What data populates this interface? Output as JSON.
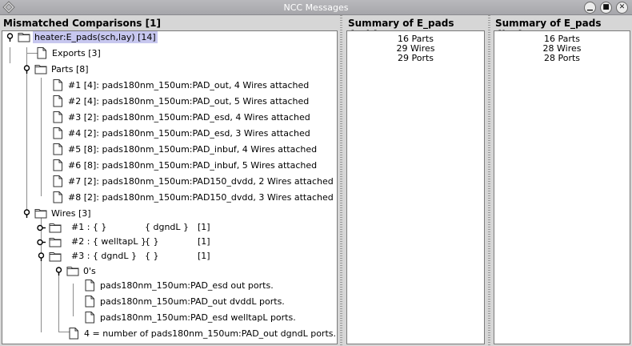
{
  "window": {
    "title": "NCC Messages"
  },
  "left_pane": {
    "header": "Mismatched Comparisons [1]",
    "tree": {
      "root": "heater:E_pads(sch,lay) [14]",
      "exports": "Exports [3]",
      "parts": "Parts [8]",
      "part_items": [
        "#1 [4]: pads180nm_150um:PAD_out, 4 Wires attached",
        "#2 [4]: pads180nm_150um:PAD_out, 5 Wires attached",
        "#3 [2]: pads180nm_150um:PAD_esd, 4 Wires attached",
        "#4 [2]: pads180nm_150um:PAD_esd, 3 Wires attached",
        "#5 [8]: pads180nm_150um:PAD_inbuf, 4 Wires attached",
        "#6 [8]: pads180nm_150um:PAD_inbuf, 5 Wires attached",
        "#7 [2]: pads180nm_150um:PAD150_dvdd, 2 Wires attached",
        "#8 [2]: pads180nm_150um:PAD150_dvdd, 3 Wires attached"
      ],
      "wires": "Wires [3]",
      "wire_items": [
        {
          "id": "#1 : { }",
          "col2": "{ dgndL }",
          "col3": "[1]"
        },
        {
          "id": "#2 : { welltapL }",
          "col2": "{ }",
          "col3": "[1]"
        },
        {
          "id": "#3 : { dgndL }",
          "col2": "{ }",
          "col3": "[1]"
        }
      ],
      "zeros": "0's",
      "zero_items": [
        "pads180nm_150um:PAD_esd out ports.",
        "pads180nm_150um:PAD_out dvddL ports.",
        "pads180nm_150um:PAD_esd welltapL ports."
      ],
      "summary_line": "4 = number of pads180nm_150um:PAD_out dgndL ports."
    }
  },
  "sch_pane": {
    "header": "Summary of E_pads {sch}",
    "lines": [
      "16 Parts",
      "29 Wires",
      "29 Ports"
    ]
  },
  "lay_pane": {
    "header": "Summary of E_pads {lay}",
    "lines": [
      "16 Parts",
      "28 Wires",
      "28 Ports"
    ]
  },
  "colors": {
    "selection": "#c7c7ef",
    "background": "#d6d6d6",
    "titlebar": "#b0b0b4"
  }
}
